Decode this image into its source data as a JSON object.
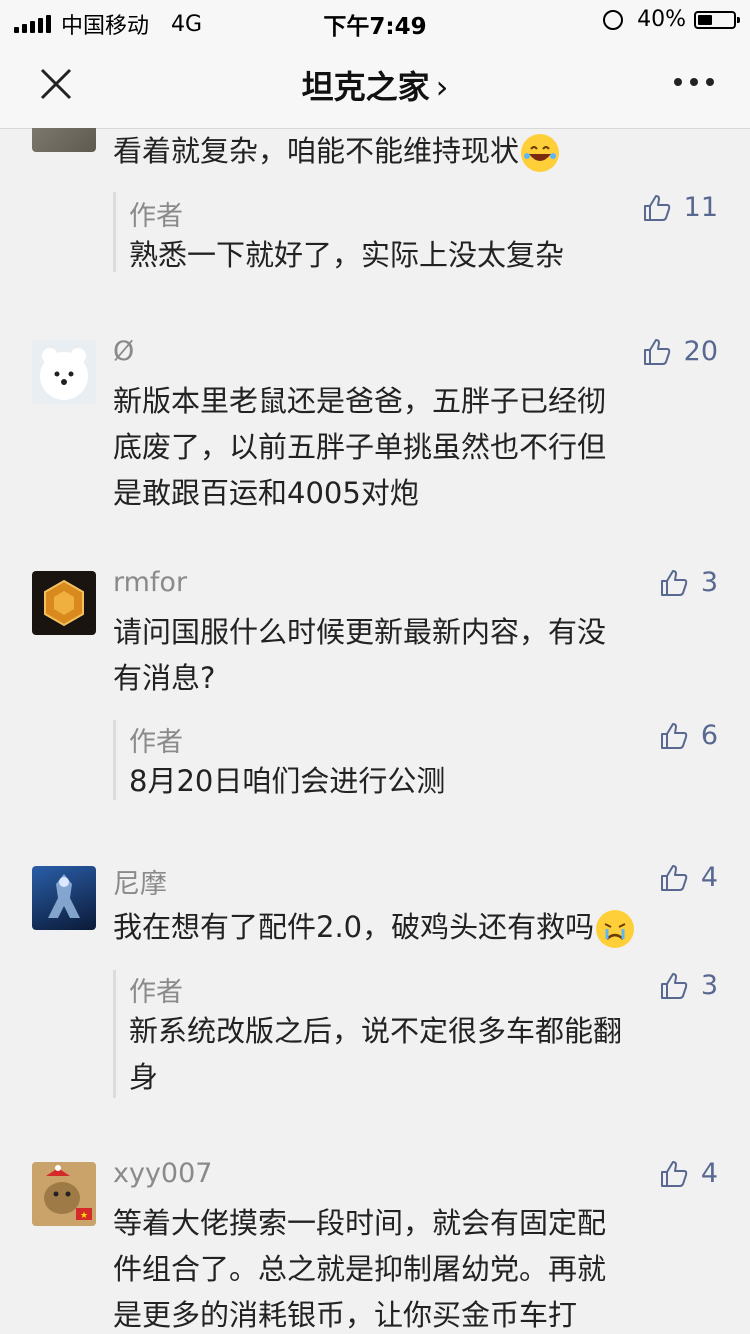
{
  "status_bar": {
    "carrier": "中国移动",
    "network": "4G",
    "time": "下午7:49",
    "battery": "40%",
    "battery_level": 0.4
  },
  "nav": {
    "title": "坦克之家",
    "chevron": "›",
    "close_icon": "close-icon",
    "more_icon": "more-icon"
  },
  "comments": [
    {
      "name": "",
      "text": "看着就复杂，咱能不能维持现状",
      "emoji": "laughing-tears-emoji",
      "replies": [
        {
          "author": "作者",
          "text": "熟悉一下就好了，实际上没太复杂",
          "likes": "11"
        }
      ]
    },
    {
      "name": "Ø",
      "likes": "20",
      "text_lines": [
        "新版本里老鼠还是爸爸，五胖子已经彻",
        "底废了，以前五胖子单挑虽然也不行但",
        "是敢跟百运和4005对炮"
      ]
    },
    {
      "name": "rmfor",
      "likes": "3",
      "text_lines": [
        "请问国服什么时候更新最新内容，有没",
        "有消息?"
      ],
      "replies": [
        {
          "author": "作者",
          "text": "8月20日咱们会进行公测",
          "likes": "6"
        }
      ]
    },
    {
      "name": "尼摩",
      "likes": "4",
      "text": "我在想有了配件2.0，破鸡头还有救吗",
      "emoji": "crying-emoji",
      "replies": [
        {
          "author": "作者",
          "text_lines": [
            "新系统改版之后，说不定很多车都能翻",
            "身"
          ],
          "likes": "3"
        }
      ]
    },
    {
      "name": "xyy007",
      "likes": "4",
      "text_lines": [
        "等着大佬摸索一段时间，就会有固定配",
        "件组合了。总之就是抑制屠幼党。再就",
        "是更多的消耗银币，让你买金币车打"
      ]
    }
  ]
}
